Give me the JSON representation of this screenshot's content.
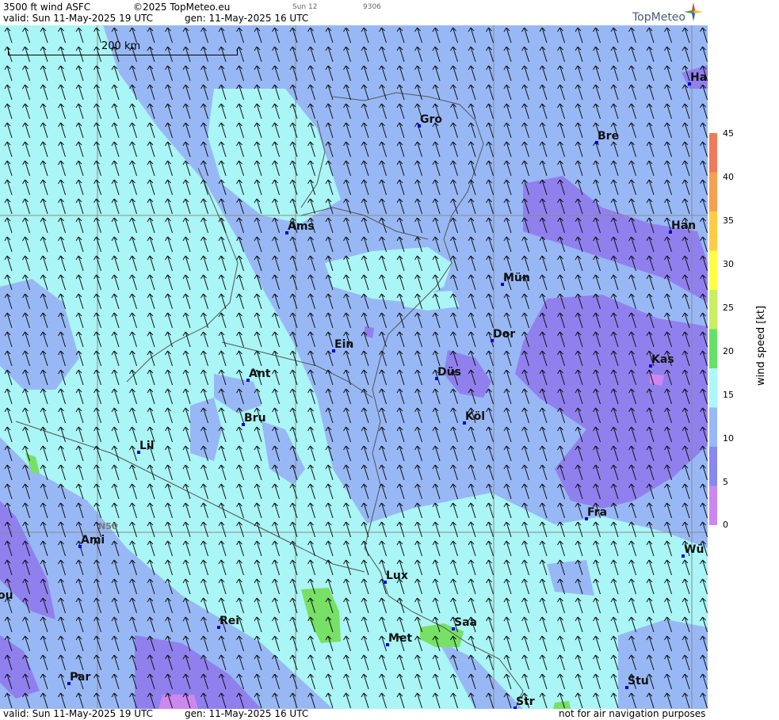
{
  "header": {
    "product": "3500 ft wind ASFC",
    "copyright": "©2025 TopMeteo.eu",
    "run_small": "Sun 12",
    "code_small": "9306",
    "valid": "valid:  Sun  11-May-2025  19 UTC",
    "gen": "gen: 11-May-2025 16 UTC",
    "logo": "TopMeteo"
  },
  "footer": {
    "valid": "valid:  Sun  11-May-2025  19 UTC",
    "gen": "gen: 11-May-2025 16 UTC",
    "disclaimer": "not for air navigation purposes"
  },
  "map": {
    "scale_label": "200 km",
    "latitude_label": "N50",
    "cities": [
      {
        "name": "Ha"
      },
      {
        "name": "Gro"
      },
      {
        "name": "Bre"
      },
      {
        "name": "Ams"
      },
      {
        "name": "Han"
      },
      {
        "name": "Mün"
      },
      {
        "name": "Ein"
      },
      {
        "name": "Dor"
      },
      {
        "name": "Kas"
      },
      {
        "name": "Ant"
      },
      {
        "name": "Düs"
      },
      {
        "name": "Bru"
      },
      {
        "name": "Köl"
      },
      {
        "name": "Lil"
      },
      {
        "name": "Fra"
      },
      {
        "name": "Ami"
      },
      {
        "name": "Wü"
      },
      {
        "name": "Lux"
      },
      {
        "name": "ou"
      },
      {
        "name": "Rei"
      },
      {
        "name": "Saa"
      },
      {
        "name": "Met"
      },
      {
        "name": "Par"
      },
      {
        "name": "Stu"
      },
      {
        "name": "Str"
      }
    ],
    "wind_direction": "south-east"
  },
  "legend": {
    "title": "wind  speed  [kt]",
    "ticks": [
      "45",
      "40",
      "35",
      "30",
      "25",
      "20",
      "15",
      "10",
      "5",
      "0"
    ],
    "colors": [
      "#f07a5a",
      "#f4a050",
      "#ffcc44",
      "#ffff44",
      "#c8f060",
      "#66e066",
      "#aaf8f8",
      "#98b8f8",
      "#8888f0",
      "#cc88f0"
    ]
  },
  "colors": {
    "cyan": "#aaf5f5",
    "blue": "#98b8f5",
    "purple": "#9080ee",
    "violet": "#cc88ee",
    "green": "#77e066"
  }
}
